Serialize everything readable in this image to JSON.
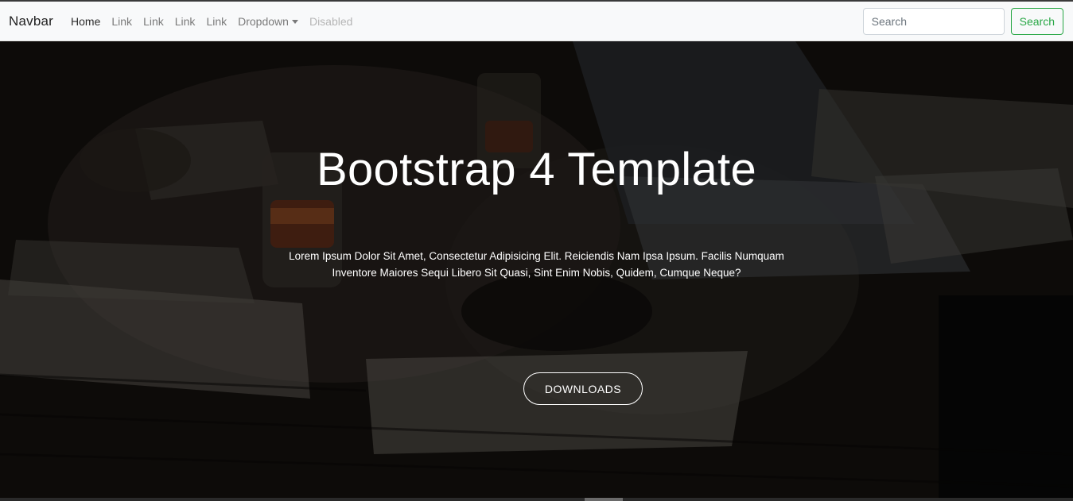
{
  "navbar": {
    "brand": "Navbar",
    "links": [
      {
        "label": "Home",
        "state": "active"
      },
      {
        "label": "Link",
        "state": "normal"
      },
      {
        "label": "Link",
        "state": "normal"
      },
      {
        "label": "Link",
        "state": "normal"
      },
      {
        "label": "Link",
        "state": "normal"
      },
      {
        "label": "Dropdown",
        "state": "dropdown"
      },
      {
        "label": "Disabled",
        "state": "disabled"
      }
    ],
    "search": {
      "placeholder": "Search",
      "button_label": "Search"
    }
  },
  "hero": {
    "title": "Bootstrap 4 Template",
    "text": "Lorem Ipsum Dolor Sit Amet, Consectetur Adipisicing Elit. Reiciendis Nam Ipsa Ipsum. Facilis Numquam Inventore Maiores Sequi Libero Sit Quasi, Sint Enim Nobis, Quidem, Cumque Neque?",
    "button_label": "DOWNLOADS",
    "background": "dark photo of people working at a desk with laptops, notebooks and drinks"
  },
  "colors": {
    "navbar_bg": "#f8f9fa",
    "search_accent": "#28a745",
    "hero_text": "#ffffff"
  },
  "icons": {
    "dropdown": "caret-down-icon"
  }
}
